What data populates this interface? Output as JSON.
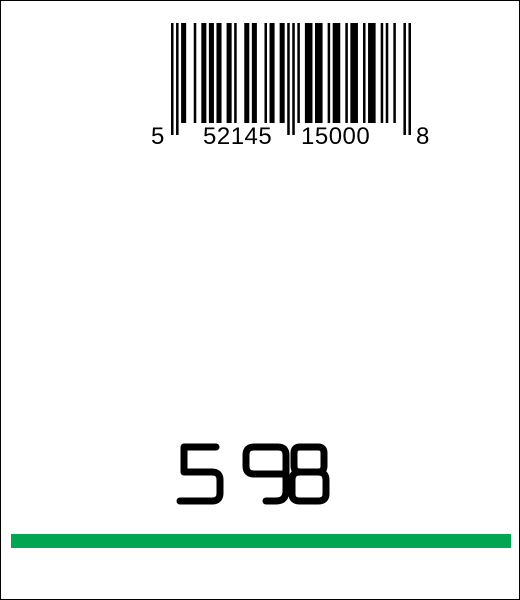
{
  "barcode": {
    "digits": "5521451500008",
    "first_digit": "5",
    "left_group": "52145",
    "right_group": "15000",
    "check_digit": "8"
  },
  "price": {
    "value": "598"
  },
  "colors": {
    "accent": "#00a651",
    "ink": "#000000",
    "background": "#ffffff"
  }
}
